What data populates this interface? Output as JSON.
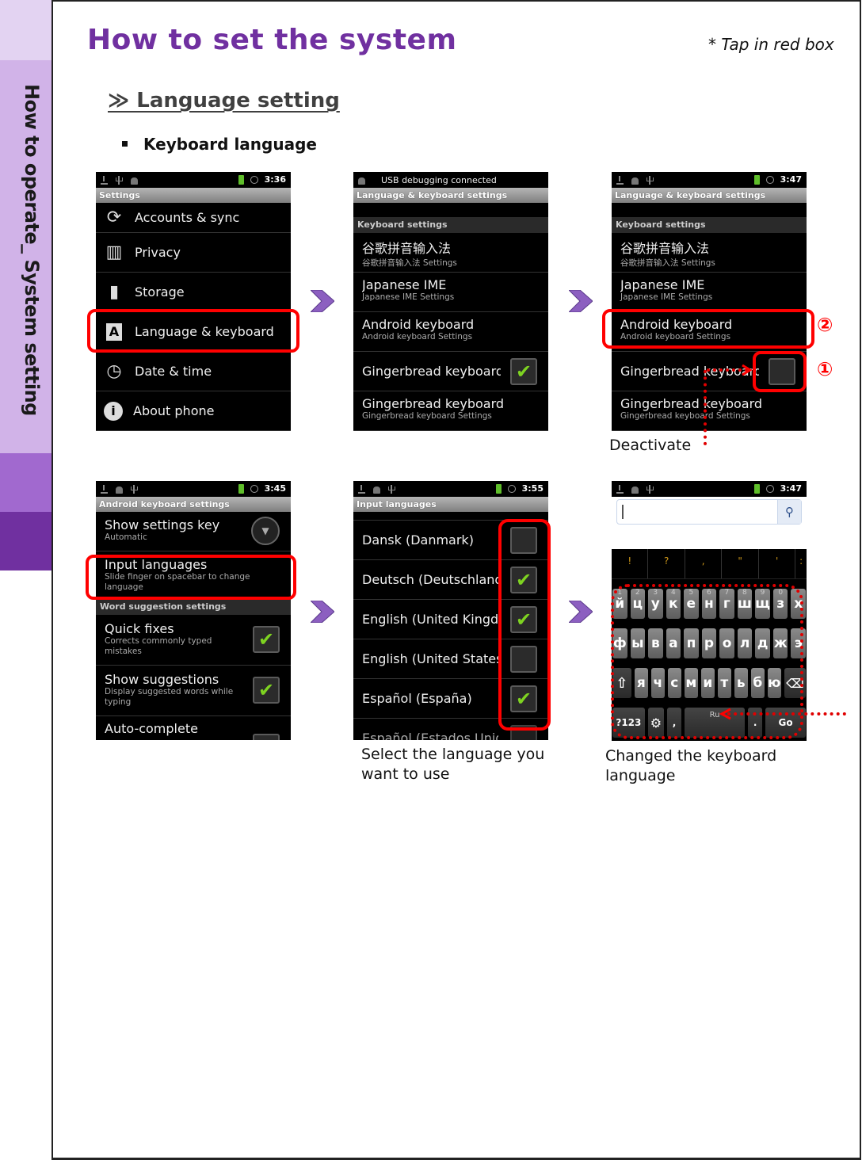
{
  "sidebar": {
    "label": "How to operate_ System setting"
  },
  "header": {
    "title": "How to set the system",
    "note": "* Tap in red box",
    "section": "≫ Language setting",
    "bullet": "Keyboard language"
  },
  "colors": {
    "accent": "#7030a0",
    "annotation": "#ff0000",
    "check": "#7ed321"
  },
  "screens": {
    "settings": {
      "time": "3:36",
      "title": "Settings",
      "items": [
        {
          "icon": "sync-icon",
          "label": "Accounts & sync"
        },
        {
          "icon": "privacy-icon",
          "label": "Privacy"
        },
        {
          "icon": "storage-icon",
          "label": "Storage"
        },
        {
          "icon": "language-icon",
          "label": "Language & keyboard"
        },
        {
          "icon": "clock-icon",
          "label": "Date & time"
        },
        {
          "icon": "info-icon",
          "label": "About phone"
        }
      ]
    },
    "lang_kb_1": {
      "status": "USB debugging connected",
      "title": "Language & keyboard settings",
      "category": "Keyboard settings",
      "items": [
        {
          "title": "谷歌拼音输入法",
          "sub": "谷歌拼音输入法 Settings"
        },
        {
          "title": "Japanese IME",
          "sub": "Japanese IME Settings"
        },
        {
          "title": "Android keyboard",
          "sub": "Android keyboard Settings"
        },
        {
          "title": "Gingerbread keyboard",
          "checked": true
        },
        {
          "title": "Gingerbread keyboard",
          "sub": "Gingerbread keyboard Settings"
        }
      ]
    },
    "lang_kb_2": {
      "time": "3:47",
      "title": "Language & keyboard settings",
      "category": "Keyboard settings",
      "items": [
        {
          "title": "谷歌拼音输入法",
          "sub": "谷歌拼音输入法 Settings"
        },
        {
          "title": "Japanese IME",
          "sub": "Japanese IME Settings"
        },
        {
          "title": "Android keyboard",
          "sub": "Android keyboard Settings"
        },
        {
          "title": "Gingerbread keyboard",
          "checked": false
        },
        {
          "title": "Gingerbread keyboard",
          "sub": "Gingerbread keyboard Settings"
        }
      ],
      "step1": "①",
      "step2": "②",
      "caption": "Deactivate"
    },
    "android_kb": {
      "time": "3:45",
      "title": "Android keyboard settings",
      "items": [
        {
          "title": "Show settings key",
          "sub": "Automatic"
        },
        {
          "title": "Input languages",
          "sub": "Slide finger on spacebar to change language"
        }
      ],
      "category": "Word suggestion settings",
      "items2": [
        {
          "title": "Quick fixes",
          "sub": "Corrects commonly typed mistakes",
          "checked": true
        },
        {
          "title": "Show suggestions",
          "sub": "Display suggested words while typing",
          "checked": true
        },
        {
          "title": "Auto-complete"
        }
      ]
    },
    "input_langs": {
      "time": "3:55",
      "title": "Input languages",
      "items": [
        {
          "title": "Dansk (Danmark)",
          "checked": false
        },
        {
          "title": "Deutsch (Deutschland)",
          "checked": true
        },
        {
          "title": "English (United Kingdom)",
          "checked": true
        },
        {
          "title": "English (United States)",
          "checked": false
        },
        {
          "title": "Español (España)",
          "checked": true
        },
        {
          "title": "Español (Estados Unidos)",
          "checked": false
        }
      ],
      "caption": "Select the language you want to use"
    },
    "keyboard": {
      "time": "3:47",
      "search_value": "",
      "suggestions": [
        "!",
        "?",
        ",",
        "\"",
        "'",
        ":"
      ],
      "row1": [
        [
          "й",
          "1"
        ],
        [
          "ц",
          "2"
        ],
        [
          "у",
          "3"
        ],
        [
          "к",
          "4"
        ],
        [
          "е",
          "5"
        ],
        [
          "н",
          "6"
        ],
        [
          "г",
          "7"
        ],
        [
          "ш",
          "8"
        ],
        [
          "щ",
          "9"
        ],
        [
          "з",
          "0"
        ],
        [
          "х",
          ""
        ]
      ],
      "row2": [
        "ф",
        "ы",
        "в",
        "а",
        "п",
        "р",
        "о",
        "л",
        "д",
        "ж",
        "э"
      ],
      "row3": [
        "я",
        "ч",
        "с",
        "м",
        "и",
        "т",
        "ь",
        "б",
        "ю"
      ],
      "sym_key": "?123",
      "space_label": "Ru",
      "comma": ",",
      "period": ".",
      "go_key": "Go",
      "caption": "Changed the keyboard language"
    }
  }
}
